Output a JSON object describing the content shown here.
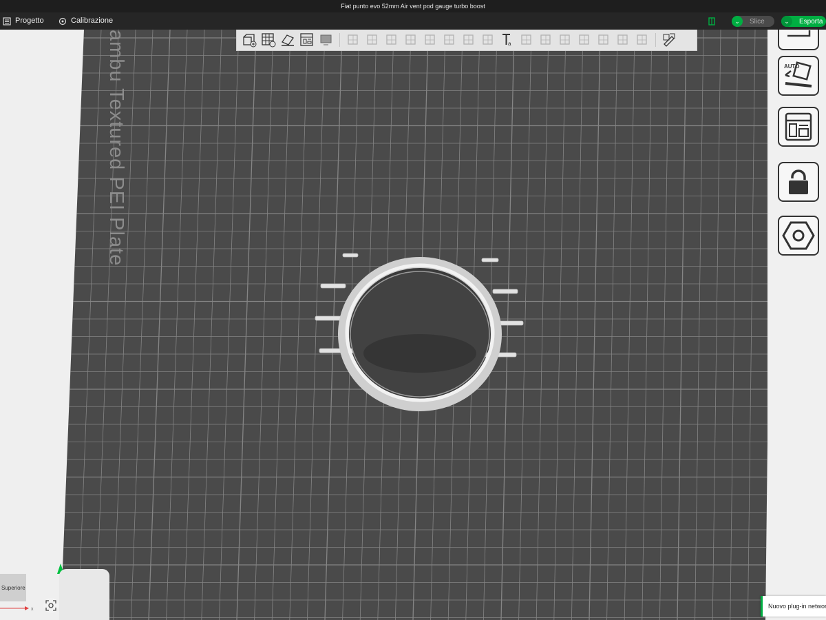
{
  "window": {
    "title": "Fiat punto evo 52mm Air vent pod gauge turbo boost"
  },
  "menu": {
    "project_label": "Progetto",
    "calibration_label": "Calibrazione",
    "slice_label": "Slice",
    "export_label": "Esporta"
  },
  "plate": {
    "name": "Bambu Textured PEI Plate",
    "visible_text": "ambu Textured PEI Plate"
  },
  "toolbar": {
    "icons": [
      "add-cube-icon",
      "arrange-grid-icon",
      "auto-orient-icon",
      "layout-icon",
      "display-icon",
      "move-icon",
      "rotate-icon",
      "scale-icon",
      "lay-on-face-icon",
      "cut-icon",
      "mesh-boolean-icon",
      "support-paint-icon",
      "seam-paint-icon",
      "text-icon",
      "variable-layer-icon",
      "color-paint-icon",
      "measure-icon",
      "assembly-icon",
      "emboss-icon",
      "brim-ears-icon",
      "split-icon",
      "object-settings-icon"
    ]
  },
  "right_panel": {
    "icons": [
      "plate-icon",
      "auto-orient-plate-icon",
      "arrange-plate-icon",
      "lock-plate-icon",
      "plate-settings-icon"
    ],
    "auto_label": "AUTO"
  },
  "view": {
    "cube_label": "Superiore",
    "axis_x_label": "x"
  },
  "notification": {
    "text": "Nuovo plug-in network"
  },
  "colors": {
    "accent": "#00ae42",
    "plate": "#4a4a4a",
    "grid": "#8a8a8a",
    "model": "#d9d9d9"
  }
}
